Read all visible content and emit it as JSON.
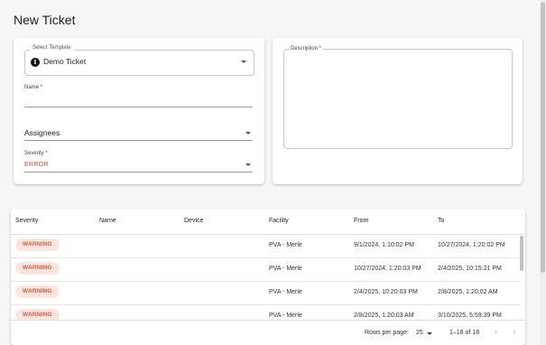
{
  "page": {
    "title": "New Ticket"
  },
  "form": {
    "template": {
      "label": "Select Template",
      "value": "Demo Ticket",
      "icon": "info-icon"
    },
    "name": {
      "label": "Name *",
      "value": ""
    },
    "assignees": {
      "label": "Assignees"
    },
    "severity": {
      "label": "Severity *",
      "value": "ERROR",
      "color": "#d84a3a"
    },
    "description": {
      "label": "Description *",
      "value": ""
    }
  },
  "table": {
    "columns": [
      "Severity",
      "Name",
      "Device",
      "Facility",
      "From",
      "To"
    ],
    "rows": [
      {
        "severity": "WARNING",
        "name": "",
        "device": "",
        "facility": "PVA - Merle",
        "from": "9/1/2024, 1:10:02 PM",
        "to": "10/27/2024, 1:20:02 PM"
      },
      {
        "severity": "WARNING",
        "name": "",
        "device": "",
        "facility": "PVA - Merle",
        "from": "10/27/2024, 1:20:03 PM",
        "to": "2/4/2025, 10:15:21 PM"
      },
      {
        "severity": "WARNING",
        "name": "",
        "device": "",
        "facility": "PVA - Merle",
        "from": "2/4/2025, 10:20:03 PM",
        "to": "2/8/2025, 1:20:02 AM"
      },
      {
        "severity": "WARNING",
        "name": "",
        "device": "",
        "facility": "PVA - Merle",
        "from": "2/8/2025, 1:20:03 AM",
        "to": "3/10/2025, 5:59:39 PM"
      }
    ],
    "footer": {
      "rows_per_page_label": "Rows per page:",
      "rows_per_page": "25",
      "range": "1–18 of 18",
      "prev_icon": "chevron-left-icon",
      "next_icon": "chevron-right-icon"
    }
  },
  "colors": {
    "warning_text": "#e05a3c",
    "warning_bg": "#fde5df"
  }
}
